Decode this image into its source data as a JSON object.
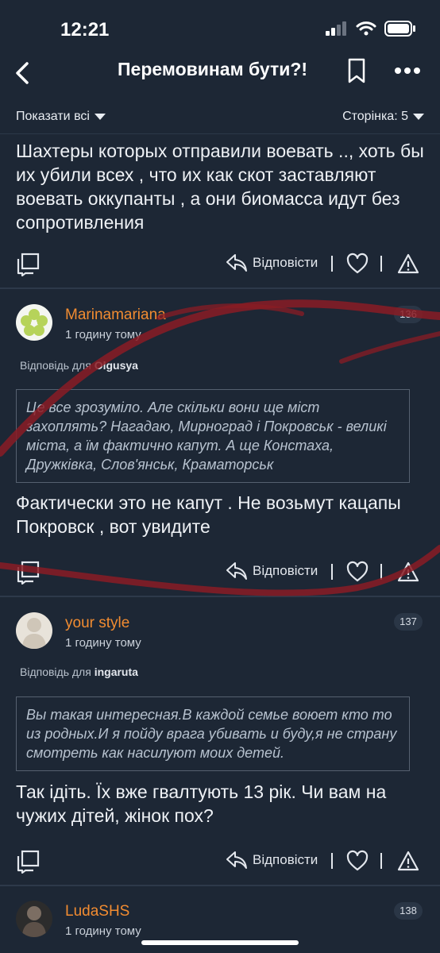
{
  "status": {
    "time": "12:21"
  },
  "nav": {
    "title": "Перемовинам бути?!"
  },
  "filters": {
    "show_all": "Показати всі",
    "page": "Сторінка: 5"
  },
  "actions_label": "Відповісти",
  "reply_prefix": "Відповідь для",
  "comments": [
    {
      "text": "Шахтеры которых отправили воевать .., хоть бы их убили всех , что их как скот заставляют воевать оккупанты , а они биомасса идут без сопротивления"
    },
    {
      "user": "Marinamariana",
      "time": "1 годину тому",
      "number": "136",
      "reply_to": "Olgusya",
      "quote": "Це все зрозуміло. Але скільки вони ще міст захоплять? Нагадаю, Мирноград і Покровськ - великі міста, а їм фактично капут. А ще Констаха, Дружківка, Слов'янськ, Краматорськ",
      "text": "Фактически это не капут . Не возьмут кацапы Покровск , вот увидите"
    },
    {
      "user": "your style",
      "time": "1 годину тому",
      "number": "137",
      "reply_to": "ingaruta",
      "quote": "Вы такая интересная.В каждой семье воюет кто то из родных.И я пойду врага убивать и буду,я не страну смотреть как насилуют моих детей.",
      "text": "Так ідіть. Їх вже гвалтують 13 рік. Чи вам на чужих дітей, жінок пох?"
    },
    {
      "user": "LudaSHS",
      "time": "1 годину тому",
      "number": "138"
    }
  ],
  "colors": {
    "background": "#1d2735",
    "username": "#f28c31",
    "overlay_stroke": "#8a1c24"
  }
}
